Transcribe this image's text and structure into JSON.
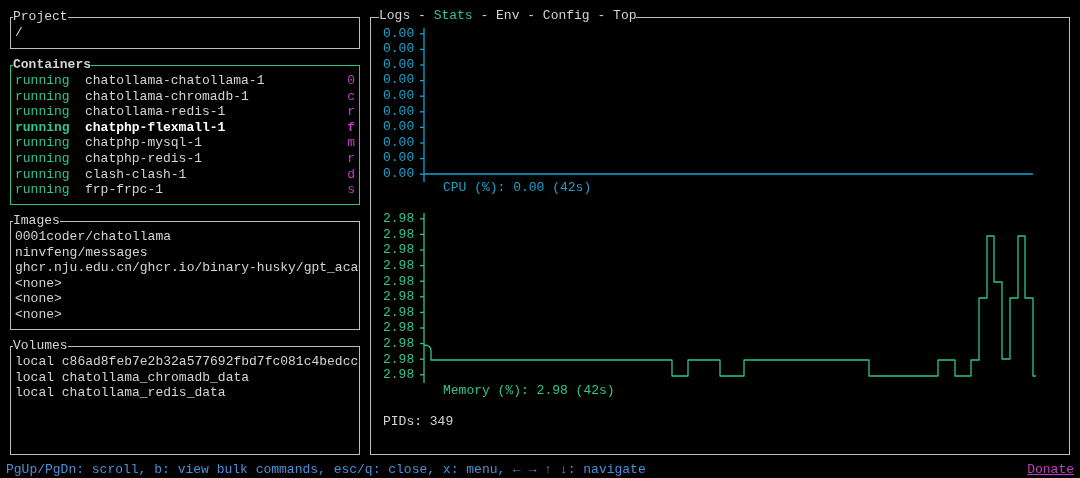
{
  "project": {
    "title": "Project",
    "path": "/"
  },
  "containers": {
    "title": "Containers",
    "items": [
      {
        "status": "running",
        "name": "chatollama-chatollama-1",
        "key": "0",
        "selected": false
      },
      {
        "status": "running",
        "name": "chatollama-chromadb-1",
        "key": "c",
        "selected": false
      },
      {
        "status": "running",
        "name": "chatollama-redis-1",
        "key": "r",
        "selected": false
      },
      {
        "status": "running",
        "name": "chatphp-flexmall-1",
        "key": "f",
        "selected": true
      },
      {
        "status": "running",
        "name": "chatphp-mysql-1",
        "key": "m",
        "selected": false
      },
      {
        "status": "running",
        "name": "chatphp-redis-1",
        "key": "r",
        "selected": false
      },
      {
        "status": "running",
        "name": "clash-clash-1",
        "key": "d",
        "selected": false
      },
      {
        "status": "running",
        "name": "frp-frpc-1",
        "key": "s",
        "selected": false
      }
    ]
  },
  "images": {
    "title": "Images",
    "items": [
      "0001coder/chatollama",
      "ninvfeng/messages",
      "ghcr.nju.edu.cn/ghcr.io/binary-husky/gpt_aca",
      "<none>",
      "<none>",
      "<none>"
    ]
  },
  "volumes": {
    "title": "Volumes",
    "items": [
      "local c86ad8feb7e2b32a577692fbd7fc081c4bedcc",
      "local chatollama_chromadb_data",
      "local chatollama_redis_data"
    ]
  },
  "main_panel": {
    "tab_separator": "-",
    "tabs": [
      {
        "label": "Logs",
        "selected": false
      },
      {
        "label": "Stats",
        "selected": true
      },
      {
        "label": "Env",
        "selected": false
      },
      {
        "label": "Config",
        "selected": false
      },
      {
        "label": "Top",
        "selected": false
      }
    ],
    "cpu_chart": {
      "y_tick_labels": [
        "0.00",
        "0.00",
        "0.00",
        "0.00",
        "0.00",
        "0.00",
        "0.00",
        "0.00",
        "0.00",
        "0.00"
      ],
      "caption": "CPU (%): 0.00 (42s)"
    },
    "memory_chart": {
      "y_tick_labels": [
        "2.98",
        "2.98",
        "2.98",
        "2.98",
        "2.98",
        "2.98",
        "2.98",
        "2.98",
        "2.98",
        "2.98",
        "2.98"
      ],
      "caption": "Memory (%): 2.98 (42s)"
    },
    "pids": "PIDs: 349"
  },
  "status_bar": {
    "hint": "PgUp/PgDn: scroll, b: view bulk commands, esc/q: close, x: menu, ← → ↑ ↓: navigate",
    "donate": "Donate"
  }
}
